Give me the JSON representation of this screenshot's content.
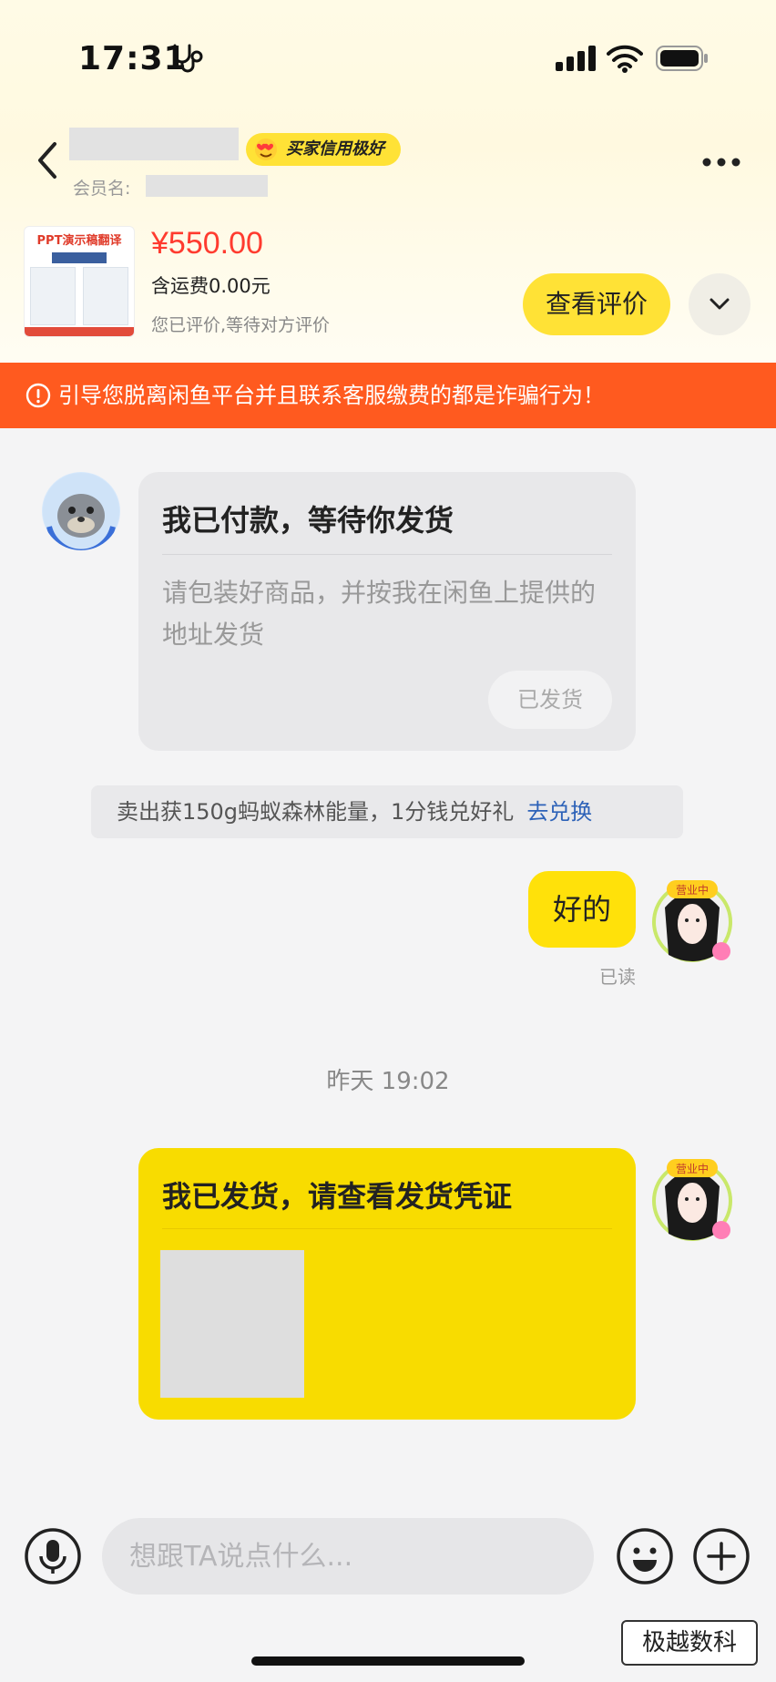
{
  "status_bar": {
    "time": "17:31"
  },
  "header": {
    "credit_badge": "买家信用极好",
    "member_label": "会员名:"
  },
  "product": {
    "thumb_title": "PPT演示稿翻译",
    "price": "¥550.00",
    "shipping": "含运费0.00元",
    "review_status": "您已评价,等待对方评价",
    "view_review_label": "查看评价"
  },
  "warning": {
    "text": "引导您脱离闲鱼平台并且联系客服缴费的都是诈骗行为！"
  },
  "messages": {
    "paid_card": {
      "title": "我已付款，等待你发货",
      "description": "请包装好商品，并按我在闲鱼上提供的地址发货",
      "button": "已发货"
    },
    "points_notice": {
      "text": "卖出获150g蚂蚁森林能量，1分钱兑好礼",
      "link": "去兑换"
    },
    "reply_ok": "好的",
    "read_status": "已读",
    "timestamp": "昨天 19:02",
    "shipped_card": {
      "title": "我已发货，请查看发货凭证"
    },
    "avatar_badge": "营业中"
  },
  "input": {
    "placeholder": "想跟TA说点什么..."
  },
  "watermark": "极越数科",
  "colors": {
    "brand_yellow": "#ffe10a",
    "warning_orange": "#ff5a1f",
    "price_red": "#ff3b2f",
    "link_blue": "#2d62b8"
  },
  "icons": [
    "stethoscope-icon",
    "signal-icon",
    "wifi-icon",
    "battery-icon",
    "back-icon",
    "more-icon",
    "chevron-down-icon",
    "warning-icon",
    "microphone-icon",
    "emoji-icon",
    "plus-icon"
  ]
}
